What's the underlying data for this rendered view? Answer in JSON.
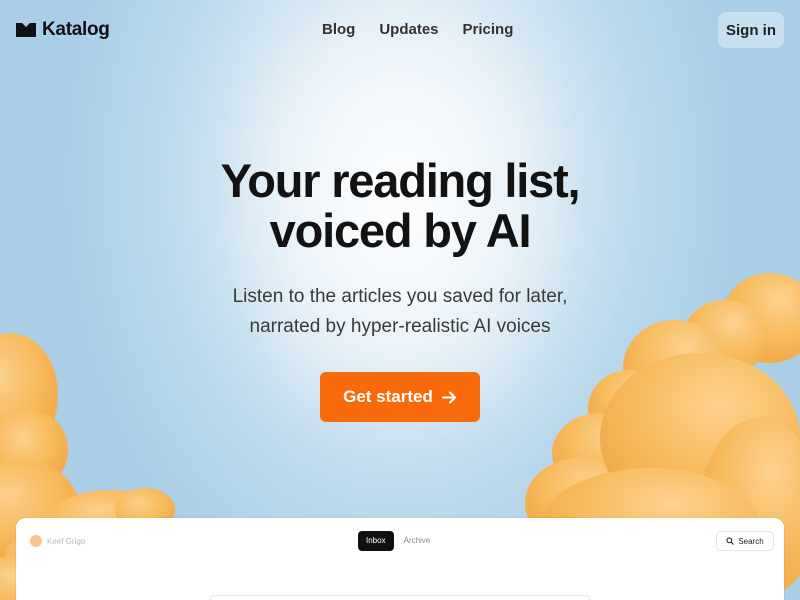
{
  "header": {
    "brand": "Katalog",
    "nav": [
      {
        "label": "Blog"
      },
      {
        "label": "Updates"
      },
      {
        "label": "Pricing"
      }
    ],
    "signin_label": "Sign in"
  },
  "hero": {
    "title_line1": "Your reading list,",
    "title_line2": "voiced by AI",
    "subtitle_line1": "Listen to the articles you saved for later,",
    "subtitle_line2": "narrated by hyper-realistic AI voices",
    "cta_label": "Get started"
  },
  "preview": {
    "user_name": "Keef Grigo",
    "tabs": [
      {
        "label": "Inbox",
        "active": true
      },
      {
        "label": "Archive",
        "active": false
      }
    ],
    "search_label": "Search"
  },
  "colors": {
    "accent": "#f96a0c",
    "sky": "#a9cee6",
    "cloud": "#f7b95a"
  },
  "icons": {
    "logo": "katalog-logo-icon",
    "cta": "arrow-right-icon",
    "search": "search-icon"
  }
}
